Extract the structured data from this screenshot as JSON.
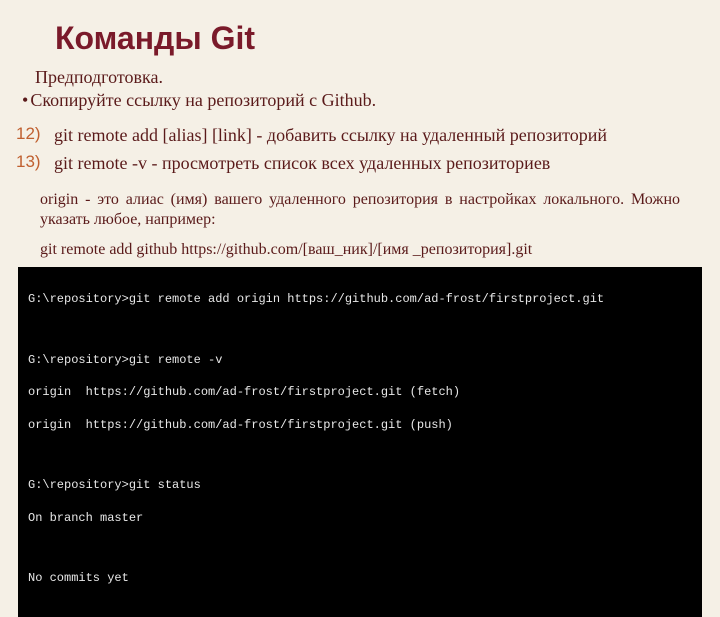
{
  "title": "Команды Git",
  "prep": "Предподготовка.",
  "bullet": "Скопируйте ссылку на репозиторий с Github.",
  "items": [
    {
      "num": "12)",
      "text": "git remote add [alias] [link] - добавить ссылку на удаленный репозиторий"
    },
    {
      "num": "13)",
      "text": "git remote -v - просмотреть список всех удаленных репозиториев"
    }
  ],
  "note1": "origin - это алиас (имя) вашего удаленного репозитория в настройках локального. Можно указать любое, например:",
  "note2": "git remote add github https://github.com/[ваш_ник]/[имя _репозитория].git",
  "terminal": {
    "l1": "G:\\repository>git remote add origin https://github.com/ad-frost/firstproject.git",
    "l2": "G:\\repository>git remote -v",
    "l3": "origin  https://github.com/ad-frost/firstproject.git (fetch)",
    "l4": "origin  https://github.com/ad-frost/firstproject.git (push)",
    "l5": "G:\\repository>git status",
    "l6": "On branch master",
    "l7": "No commits yet"
  }
}
